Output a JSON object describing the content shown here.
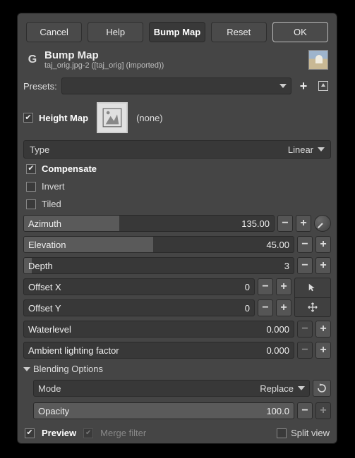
{
  "buttons": {
    "cancel": "Cancel",
    "help": "Help",
    "title_tab": "Bump Map",
    "reset": "Reset",
    "ok": "OK"
  },
  "header": {
    "title": "Bump Map",
    "subtitle": "taj_orig.jpg-2 ([taj_orig] (imported))"
  },
  "presets": {
    "label": "Presets:"
  },
  "heightmap": {
    "label": "Height Map",
    "value": "(none)",
    "checked": true
  },
  "type_row": {
    "label": "Type",
    "value": "Linear"
  },
  "checks": {
    "compensate": {
      "label": "Compensate",
      "checked": true
    },
    "invert": {
      "label": "Invert",
      "checked": false
    },
    "tiled": {
      "label": "Tiled",
      "checked": false
    }
  },
  "sliders": {
    "azimuth": {
      "label": "Azimuth",
      "value": "135.00",
      "fill_pct": 38
    },
    "elevation": {
      "label": "Elevation",
      "value": "45.00",
      "fill_pct": 48
    },
    "depth": {
      "label": "Depth",
      "value": "3",
      "fill_pct": 3
    },
    "offset_x": {
      "label": "Offset X",
      "value": "0",
      "fill_pct": 0
    },
    "offset_y": {
      "label": "Offset Y",
      "value": "0",
      "fill_pct": 0
    },
    "waterlevel": {
      "label": "Waterlevel",
      "value": "0.000",
      "fill_pct": 0
    },
    "ambient": {
      "label": "Ambient lighting factor",
      "value": "0.000",
      "fill_pct": 0
    }
  },
  "blending": {
    "header": "Blending Options",
    "mode_label": "Mode",
    "mode_value": "Replace",
    "opacity_label": "Opacity",
    "opacity_value": "100.0"
  },
  "footer": {
    "preview": "Preview",
    "merge": "Merge filter",
    "split": "Split view"
  }
}
